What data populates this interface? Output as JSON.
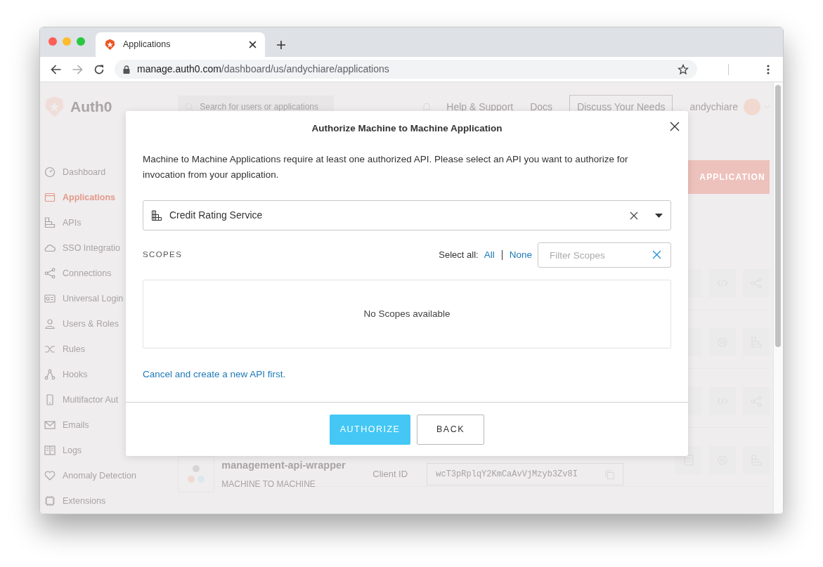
{
  "browser": {
    "tab_title": "Applications",
    "url_host": "manage.auth0.com",
    "url_path": "/dashboard/us/andychiare/applications"
  },
  "app": {
    "logo_text": "Auth0",
    "search_placeholder": "Search for users or applications",
    "header_links": [
      "Help & Support",
      "Docs"
    ],
    "discuss_button": "Discuss Your Needs",
    "username": "andychiare",
    "sidebar": [
      {
        "label": "Dashboard",
        "selected": false
      },
      {
        "label": "Applications",
        "selected": true
      },
      {
        "label": "APIs",
        "selected": false
      },
      {
        "label": "SSO Integratio",
        "selected": false
      },
      {
        "label": "Connections",
        "selected": false
      },
      {
        "label": "Universal Login",
        "selected": false
      },
      {
        "label": "Users & Roles",
        "selected": false
      },
      {
        "label": "Rules",
        "selected": false
      },
      {
        "label": "Hooks",
        "selected": false
      },
      {
        "label": "Multifactor Aut",
        "selected": false
      },
      {
        "label": "Emails",
        "selected": false
      },
      {
        "label": "Logs",
        "selected": false
      },
      {
        "label": "Anomaly Detection",
        "selected": false
      },
      {
        "label": "Extensions",
        "selected": false
      }
    ],
    "create_button": "APPLICATION",
    "rows": [
      {
        "kind": "regular"
      },
      {
        "kind": "m2m"
      },
      {
        "kind": "regular"
      },
      {
        "kind": "m2m",
        "name": "management-api-wrapper",
        "type": "MACHINE TO MACHINE",
        "client_label": "Client ID",
        "client_id": "wcT3pRplqY2KmCaAvVjMzyb3Zv8I"
      }
    ]
  },
  "modal": {
    "title": "Authorize Machine to Machine Application",
    "description": "Machine to Machine Applications require at least one authorized API. Please select an API you want to authorize for invocation from your application.",
    "api_select": {
      "value": "Credit Rating Service"
    },
    "scopes_label": "SCOPES",
    "select_all_label": "Select all:",
    "select_all_links": [
      "All",
      "None"
    ],
    "filter": {
      "placeholder": "Filter Scopes"
    },
    "empty_message": "No Scopes available",
    "cancel_link": "Cancel and create a new API first.",
    "buttons": [
      {
        "label": "AUTHORIZE",
        "kind": "primary"
      },
      {
        "label": "BACK",
        "kind": "secondary"
      }
    ]
  }
}
